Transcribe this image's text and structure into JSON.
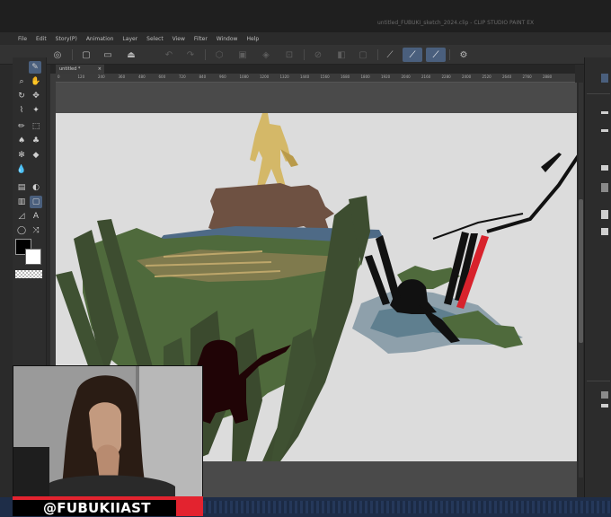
{
  "window": {
    "title": "untitled_FUBUKI_sketch_2024.clip - CLIP STUDIO PAINT EX"
  },
  "menu": [
    "File",
    "Edit",
    "Story(P)",
    "Animation",
    "Layer",
    "Select",
    "View",
    "Filter",
    "Window",
    "Help"
  ],
  "document_tab": {
    "label": "untitled *",
    "close": "×"
  },
  "ruler_ticks": [
    "0",
    "120",
    "240",
    "360",
    "480",
    "600",
    "720",
    "840",
    "960",
    "1080",
    "1200",
    "1320",
    "1440",
    "1560",
    "1680",
    "1800",
    "1920",
    "2040",
    "2160",
    "2280",
    "2400",
    "2520",
    "2640",
    "2760",
    "2880"
  ],
  "toolbar_icons": [
    "navigator-icon",
    "new-file-icon",
    "open-file-icon",
    "save-icon",
    "undo-icon",
    "redo-icon",
    "clear-icon",
    "fill-icon",
    "transform-icon",
    "deselect-icon",
    "invert-selection-icon",
    "pen-pressure-icon",
    "brush-size-icon",
    "stabilization-icon",
    "settings-icon"
  ],
  "tools": [
    "zoom-icon",
    "hand-icon",
    "rotate-icon",
    "move-icon",
    "selection-icon",
    "wand-icon",
    "eyedropper-icon",
    "pen-icon",
    "pencil-icon",
    "brush-icon",
    "airbrush-icon",
    "decoration-icon",
    "eraser-icon",
    "blend-icon",
    "fill-icon",
    "gradient-icon",
    "figure-icon",
    "frame-icon",
    "text-icon",
    "balloon-icon",
    "line-fix-icon",
    "correct-line-icon"
  ],
  "colors": {
    "foreground": "#000000",
    "background": "#ffffff",
    "accent": "#4a5f7d",
    "handle_red": "#e3232f"
  },
  "streamer": {
    "handle": "@FUBUKIIAST"
  }
}
